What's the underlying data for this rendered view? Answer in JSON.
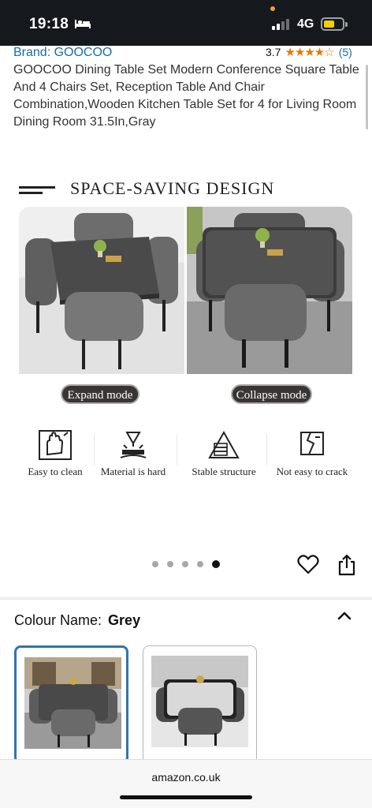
{
  "status_bar": {
    "time": "19:18",
    "network": "4G"
  },
  "product": {
    "brand": "Brand: GOOCOO",
    "rating": "3.7",
    "stars": "★★★★☆",
    "review_count": "(5)",
    "title": "GOOCOO Dining Table Set Modern Conference Square Table And 4 Chairs Set, Reception Table And Chair Combination,Wooden Kitchen Table Set for 4 for Living Room Dining Room 31.5In,Gray"
  },
  "hero_image": {
    "heading": "SPACE-SAVING DESIGN",
    "modes": [
      "Expand mode",
      "Collapse mode"
    ],
    "features": [
      "Easy to clean",
      "Material is hard",
      "Stable structure",
      "Not easy to crack"
    ]
  },
  "carousel": {
    "total": 5,
    "active_index": 4
  },
  "colour": {
    "label": "Colour Name:",
    "value": "Grey"
  },
  "browser": {
    "url": "amazon.co.uk"
  },
  "colors": {
    "link": "#1a6aa6",
    "star": "#e07b00",
    "selected_border": "#2f74b5",
    "status_bg": "#15191e"
  }
}
